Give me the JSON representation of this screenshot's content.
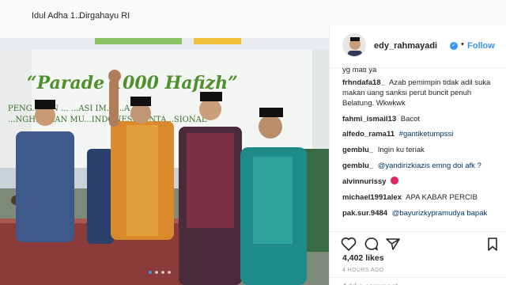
{
  "highlights": [
    {
      "label": "Idul Adha 1..."
    },
    {
      "label": "Dirgahayu RI"
    }
  ],
  "photo": {
    "banner_text": "“Parade 1000 Hafizh”",
    "banner_sub1": "PENG...GAN ... ...ASI IM... ...A &",
    "banner_sub2": "...NGH...ARAN MU...INDONESIA...NTA...SIONAL"
  },
  "post": {
    "username": "edy_rahmayadi",
    "verified_icon": "verified-badge-icon",
    "separator": "•",
    "follow_label": "Follow",
    "comments": [
      {
        "user": "yg mati ya",
        "text": ""
      },
      {
        "user": "frhndafa18_",
        "text": "Azab pemimpin tidak adil suka makan uang sanksi perut buncit penuh Belatung. Wkwkwk"
      },
      {
        "user": "fahmi_ismail13",
        "text": "Bacot"
      },
      {
        "user": "alfedo_rama11",
        "text": "#gantiketumpssi"
      },
      {
        "user": "gemblu_",
        "text": "Ingin ku teriak"
      },
      {
        "user": "gemblu_",
        "text": "@yandirizkiazis emng doi afk ?"
      },
      {
        "user": "alvinnurissy",
        "text": ""
      },
      {
        "user": "michael1991alex",
        "text": "APA KABAR PERCIB"
      },
      {
        "user": "pak.sur.9484",
        "text": "@bayurizkypramudya bapak"
      }
    ],
    "likes": "4,402 likes",
    "time_ago": "4 HOURS AGO",
    "add_comment_placeholder": "Add a comment..."
  },
  "colors": {
    "accent": "#3897f0",
    "mention": "#003569",
    "text": "#262626",
    "muted": "#999999"
  },
  "icons": [
    "heart-icon",
    "comment-icon",
    "share-icon",
    "bookmark-icon",
    "devil-emoji-icon"
  ]
}
